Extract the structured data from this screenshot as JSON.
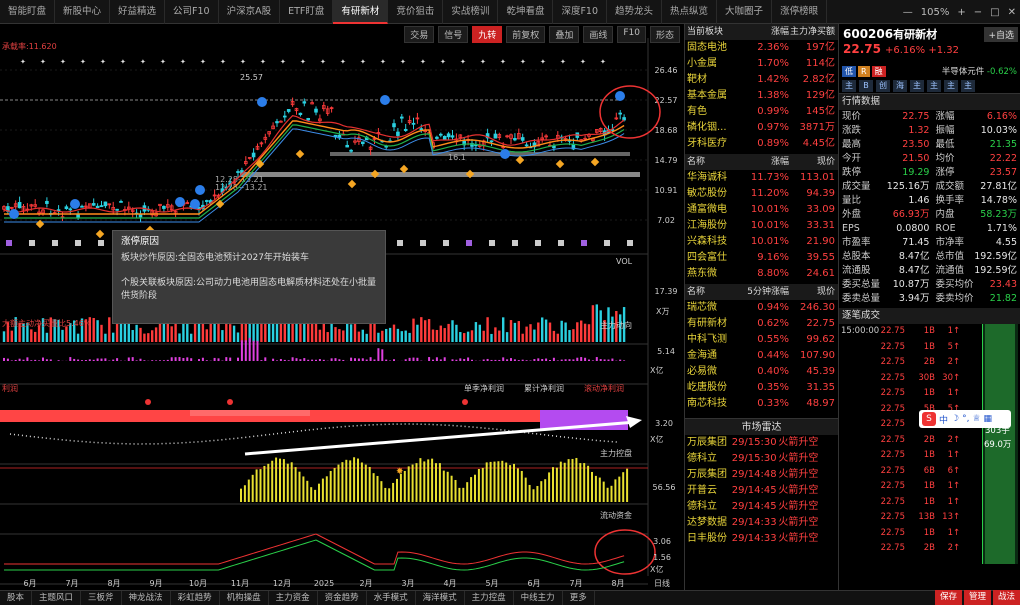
{
  "tabs": [
    {
      "label": "智能盯盘"
    },
    {
      "label": "新股中心"
    },
    {
      "label": "好益精选"
    },
    {
      "label": "公司F10"
    },
    {
      "label": "沪深京A股"
    },
    {
      "label": "ETF盯盘"
    },
    {
      "label": "有研新材",
      "active": true
    },
    {
      "label": "竞价狙击"
    },
    {
      "label": "实战榜训"
    },
    {
      "label": "乾坤看盘"
    },
    {
      "label": "深度F10"
    },
    {
      "label": "趋势龙头"
    },
    {
      "label": "热点纵览"
    },
    {
      "label": "大咖圈子"
    },
    {
      "label": "涨停榜眼"
    }
  ],
  "window": {
    "zoom": "105%"
  },
  "toolbar": [
    "交易",
    "信号",
    "九转",
    "前复权",
    "叠加",
    "画线",
    "F10",
    "形态"
  ],
  "chart": {
    "resistance_label": "承载率:11.620",
    "price_ticks": [
      "26.46",
      "22.57",
      "18.68",
      "14.79",
      "10.91",
      "7.02"
    ],
    "hi_label": "25.57",
    "low_label1": "12.28-13.21",
    "low_label2": "12.28~13.21",
    "mid_label": "16.1",
    "vol_label": "VOL",
    "vol_ticks": [
      "17.39",
      "X万"
    ],
    "main_flow_label": "主力动向",
    "main_flow_tick": [
      "5.14",
      "X亿"
    ],
    "big_flow_label": "大额主动净买量比5.46%",
    "profit_labels": [
      "单季净利润",
      "累计净利润",
      "滚动净利润"
    ],
    "profit_tag": "利润",
    "profit_tick": [
      "3.20",
      "X亿"
    ],
    "control_label": "主力控盘",
    "control_tick": "56.56",
    "liquidity_label": "流动资金",
    "liquidity_ticks": [
      "3.06",
      "1.56",
      "X亿"
    ],
    "x_ticks": [
      "6月",
      "7月",
      "8月",
      "9月",
      "10月",
      "11月",
      "12月",
      "2025",
      "2月",
      "3月",
      "4月",
      "5月",
      "6月",
      "7月",
      "8月"
    ],
    "day_label": "日线"
  },
  "tooltip": {
    "title": "涨停原因",
    "line1": "板块炒作原因:全固态电池预计2027年开始装车",
    "line2": "个股关联板块原因:公司动力电池用固态电解质材料还处在小批量供货阶段"
  },
  "sectors": {
    "header": [
      "当前板块",
      "涨幅",
      "主力净买额"
    ],
    "rows": [
      {
        "name": "固态电池",
        "chg": "2.36%",
        "amt": "197亿"
      },
      {
        "name": "小金属",
        "chg": "1.70%",
        "amt": "114亿"
      },
      {
        "name": "靶材",
        "chg": "1.42%",
        "amt": "2.82亿"
      },
      {
        "name": "基本金属",
        "chg": "1.38%",
        "amt": "129亿"
      },
      {
        "name": "有色",
        "chg": "0.99%",
        "amt": "145亿"
      },
      {
        "name": "磷化铟...",
        "chg": "0.97%",
        "amt": "3871万"
      },
      {
        "name": "牙科医疗",
        "chg": "0.89%",
        "amt": "4.45亿"
      }
    ]
  },
  "leaders": {
    "header": [
      "名称",
      "涨幅",
      "现价"
    ],
    "rows": [
      {
        "name": "华海诚科",
        "chg": "11.73%",
        "price": "113.01"
      },
      {
        "name": "敏芯股份",
        "chg": "11.20%",
        "price": "94.39"
      },
      {
        "name": "通富微电",
        "chg": "10.01%",
        "price": "33.09"
      },
      {
        "name": "江海股份",
        "chg": "10.01%",
        "price": "33.31"
      },
      {
        "name": "兴森科技",
        "chg": "10.01%",
        "price": "21.90"
      },
      {
        "name": "四会富仕",
        "chg": "9.16%",
        "price": "39.55"
      },
      {
        "name": "燕东微",
        "chg": "8.80%",
        "price": "24.61"
      }
    ]
  },
  "fivemin": {
    "header": [
      "名称",
      "5分钟涨幅",
      "现价"
    ],
    "rows": [
      {
        "name": "瑞芯微",
        "chg": "0.94%",
        "price": "246.30"
      },
      {
        "name": "有研新材",
        "chg": "0.62%",
        "price": "22.75"
      },
      {
        "name": "中科飞测",
        "chg": "0.55%",
        "price": "99.62"
      },
      {
        "name": "金海通",
        "chg": "0.44%",
        "price": "107.90"
      },
      {
        "name": "必易微",
        "chg": "0.40%",
        "price": "45.39"
      },
      {
        "name": "屹唐股份",
        "chg": "0.35%",
        "price": "31.35"
      },
      {
        "name": "南芯科技",
        "chg": "0.33%",
        "price": "48.97"
      }
    ]
  },
  "radar": {
    "title": "市场雷达",
    "rows": [
      {
        "name": "万辰集团",
        "time": "29/15:30",
        "event": "火箭升空"
      },
      {
        "name": "德科立",
        "time": "29/15:30",
        "event": "火箭升空"
      },
      {
        "name": "万辰集团",
        "time": "29/14:48",
        "event": "火箭升空"
      },
      {
        "name": "开普云",
        "time": "29/14:45",
        "event": "火箭升空"
      },
      {
        "name": "德科立",
        "time": "29/14:45",
        "event": "火箭升空"
      },
      {
        "name": "达梦数据",
        "time": "29/14:33",
        "event": "火箭升空"
      },
      {
        "name": "日丰股份",
        "time": "29/14:33",
        "event": "火箭升空"
      }
    ]
  },
  "stock": {
    "code": "600206",
    "name": "有研新材",
    "zixuan": "+自选",
    "price": "22.75",
    "chg": "+6.16%",
    "chg_abs": "+1.32",
    "sector": "半导体元件",
    "sector_chg": "-0.62%",
    "tags": [
      "低",
      "R",
      "融"
    ],
    "icons": [
      "主",
      "B",
      "创",
      "海",
      "主",
      "主",
      "主",
      "主"
    ],
    "quote_title": "行情数据",
    "quote": [
      {
        "k": "现价",
        "v": "22.75",
        "k2": "涨幅",
        "v2": "6.16%"
      },
      {
        "k": "涨跌",
        "v": "1.32",
        "k2": "振幅",
        "v2": "10.03%"
      },
      {
        "k": "最高",
        "v": "23.50",
        "k2": "最低",
        "v2": "21.35"
      },
      {
        "k": "今开",
        "v": "21.50",
        "k2": "均价",
        "v2": "22.22"
      },
      {
        "k": "跌停",
        "v": "19.29",
        "k2": "涨停",
        "v2": "23.57"
      },
      {
        "k": "成交量",
        "v": "125.16万",
        "k2": "成交额",
        "v2": "27.81亿"
      },
      {
        "k": "量比",
        "v": "1.46",
        "k2": "换手率",
        "v2": "14.78%"
      },
      {
        "k": "外盘",
        "v": "66.93万",
        "k2": "内盘",
        "v2": "58.23万"
      },
      {
        "k": "EPS",
        "v": "0.0800",
        "k2": "ROE",
        "v2": "1.71%"
      },
      {
        "k": "市盈率",
        "v": "71.45",
        "k2": "市净率",
        "v2": "4.55"
      },
      {
        "k": "总股本",
        "v": "8.47亿",
        "k2": "总市值",
        "v2": "192.59亿"
      },
      {
        "k": "流通股",
        "v": "8.47亿",
        "k2": "流通值",
        "v2": "192.59亿"
      },
      {
        "k": "委买总量",
        "v": "10.87万",
        "k2": "委买均价",
        "v2": "23.43"
      },
      {
        "k": "委卖总量",
        "v": "3.94万",
        "k2": "委卖均价",
        "v2": "21.82"
      }
    ],
    "ticks_title": "逐笔成交",
    "ticks": [
      {
        "t": "15:00:00",
        "p": "22.75",
        "v": "1B",
        "n": "1"
      },
      {
        "t": "",
        "p": "22.75",
        "v": "1B",
        "n": "5"
      },
      {
        "t": "",
        "p": "22.75",
        "v": "2B",
        "n": "2"
      },
      {
        "t": "",
        "p": "22.75",
        "v": "30B",
        "n": "30"
      },
      {
        "t": "",
        "p": "22.75",
        "v": "1B",
        "n": "1"
      },
      {
        "t": "",
        "p": "22.75",
        "v": "5B",
        "n": "5"
      },
      {
        "t": "",
        "p": "22.75",
        "v": "2B",
        "n": "2"
      },
      {
        "t": "",
        "p": "22.75",
        "v": "2B",
        "n": "2"
      },
      {
        "t": "",
        "p": "22.75",
        "v": "1B",
        "n": "1"
      },
      {
        "t": "",
        "p": "22.75",
        "v": "6B",
        "n": "6"
      },
      {
        "t": "",
        "p": "22.75",
        "v": "1B",
        "n": "1"
      },
      {
        "t": "",
        "p": "22.75",
        "v": "1B",
        "n": "1"
      },
      {
        "t": "",
        "p": "22.75",
        "v": "13B",
        "n": "13"
      },
      {
        "t": "",
        "p": "22.75",
        "v": "1B",
        "n": "1"
      },
      {
        "t": "",
        "p": "22.75",
        "v": "2B",
        "n": "2"
      }
    ],
    "vol_bar": "303手",
    "vol_amt": "69.0万"
  },
  "bottom_tabs": [
    "股本",
    "主题风口",
    "三板斧",
    "神龙战法",
    "彩虹趋势",
    "机构操盘",
    "主力资金",
    "资金趋势",
    "水手模式",
    "海洋模式",
    "主力控盘",
    "中线主力",
    "更多"
  ],
  "bottom_right": [
    "保存",
    "管理",
    "战法"
  ]
}
